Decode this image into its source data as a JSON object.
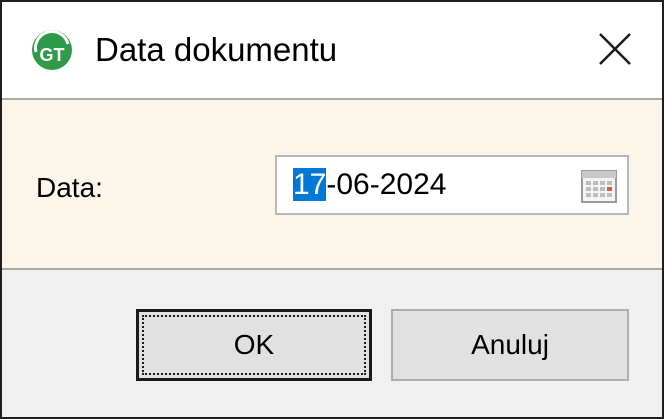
{
  "window": {
    "title": "Data dokumentu",
    "icon": "gt-app-icon",
    "icon_text": "GT"
  },
  "form": {
    "date_label": "Data:",
    "date_value": {
      "selected_part": "17",
      "rest": "-06-2024"
    },
    "calendar_icon": "calendar-icon"
  },
  "buttons": {
    "ok_label": "OK",
    "cancel_label": "Anuluj"
  },
  "colors": {
    "content_background": "#fbf5ea",
    "selection": "#0078d7",
    "app_icon_green": "#2e9a4a"
  }
}
